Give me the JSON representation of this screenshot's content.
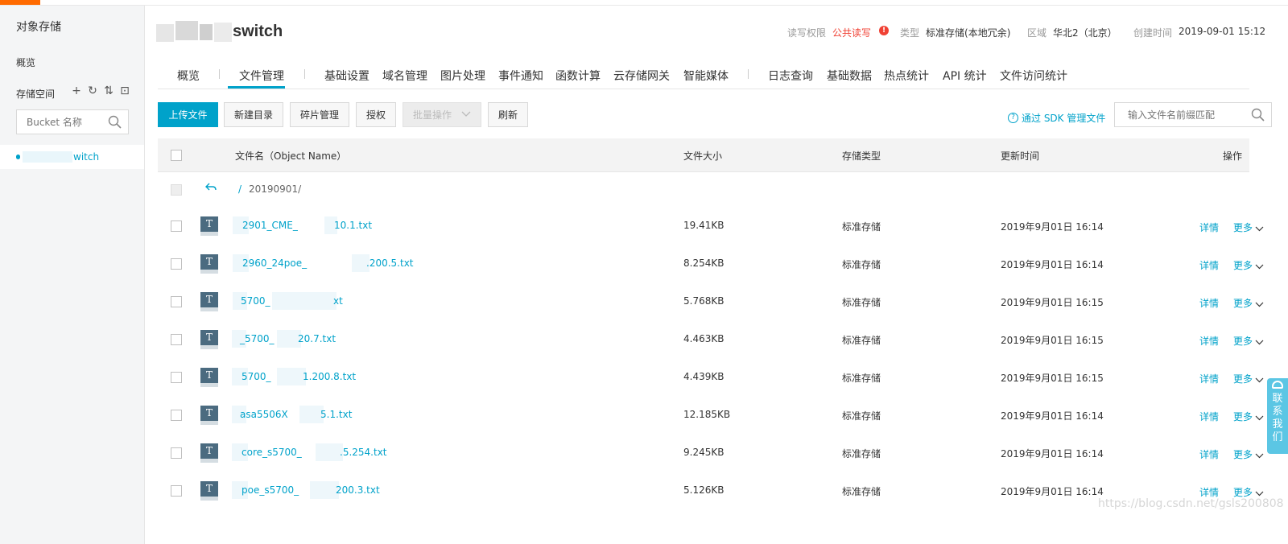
{
  "sidebar": {
    "title": "对象存储",
    "overview": "概览",
    "storage_space": "存储空间",
    "search_placeholder": "Bucket 名称",
    "bucket_name": "witch"
  },
  "header": {
    "bucket_title": "switch",
    "read_write_label": "读写权限",
    "read_write_value": "公共读写",
    "type_label": "类型",
    "type_value": "标准存储(本地冗余)",
    "region_label": "区域",
    "region_value": "华北2（北京）",
    "created_label": "创建时间",
    "created_value": "2019-09-01 15:12"
  },
  "tabs": [
    "概览",
    "文件管理",
    "基础设置",
    "域名管理",
    "图片处理",
    "事件通知",
    "函数计算",
    "云存储网关",
    "智能媒体",
    "日志查询",
    "基础数据",
    "热点统计",
    "API 统计",
    "文件访问统计"
  ],
  "toolbar": {
    "upload": "上传文件",
    "new_dir": "新建目录",
    "fragments": "碎片管理",
    "authorize": "授权",
    "batch": "批量操作",
    "refresh": "刷新",
    "sdk_link": "通过 SDK 管理文件",
    "search_placeholder": "输入文件名前缀匹配"
  },
  "table": {
    "columns": {
      "name": "文件名（Object Name）",
      "size": "文件大小",
      "storage_type": "存储类型",
      "updated": "更新时间",
      "actions": "操作"
    },
    "path": {
      "root": "/",
      "folder": "20190901/"
    },
    "rows": [
      {
        "name": "2901_CME_",
        "name2": "10.1.txt",
        "size": "19.41KB",
        "type": "标准存储",
        "time": "2019年9月01日 16:14"
      },
      {
        "name": "2960_24poe_",
        "name2": ".200.5.txt",
        "size": "8.254KB",
        "type": "标准存储",
        "time": "2019年9月01日 16:14"
      },
      {
        "name": "5700_",
        "name2": "xt",
        "size": "5.768KB",
        "type": "标准存储",
        "time": "2019年9月01日 16:15"
      },
      {
        "name": "_5700_",
        "name2": "20.7.txt",
        "size": "4.463KB",
        "type": "标准存储",
        "time": "2019年9月01日 16:15"
      },
      {
        "name": "5700_",
        "name2": "1.200.8.txt",
        "size": "4.439KB",
        "type": "标准存储",
        "time": "2019年9月01日 16:15"
      },
      {
        "name": "asa5506X",
        "name2": "5.1.txt",
        "size": "12.185KB",
        "type": "标准存储",
        "time": "2019年9月01日 16:14"
      },
      {
        "name": "core_s5700_",
        "name2": ".5.254.txt",
        "size": "9.245KB",
        "type": "标准存储",
        "time": "2019年9月01日 16:14"
      },
      {
        "name": "poe_s5700_",
        "name2": "200.3.txt",
        "size": "5.126KB",
        "type": "标准存储",
        "time": "2019年9月01日 16:14"
      }
    ],
    "detail_label": "详情",
    "more_label": "更多"
  },
  "contact": "联系我们",
  "watermark": "https://blog.csdn.net/gsls200808",
  "colors": {
    "accent": "#00a2ca",
    "brand_orange": "#ff6a00",
    "warning_red": "#f04134"
  }
}
